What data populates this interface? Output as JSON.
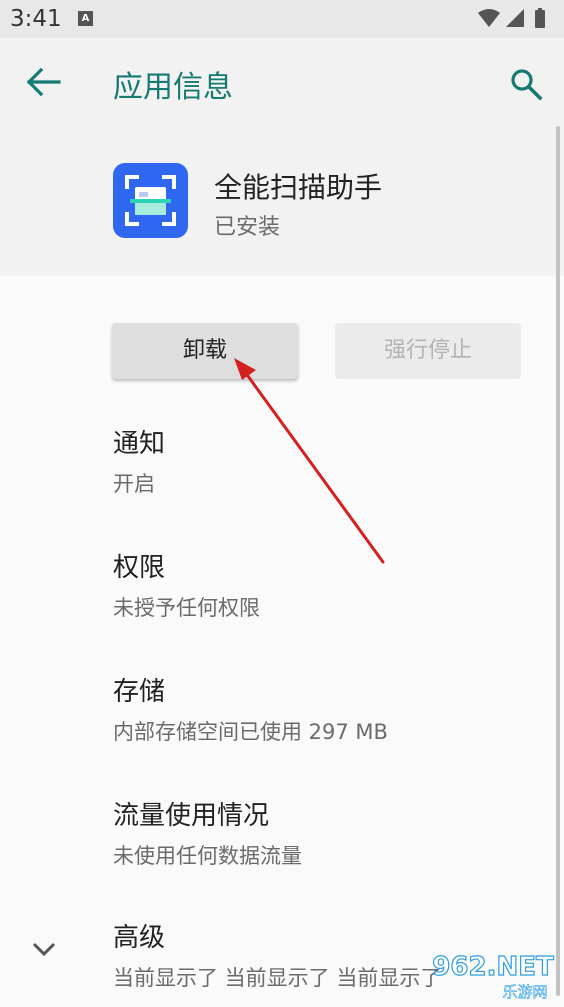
{
  "status_bar": {
    "time": "3:41",
    "notification_badge": "A",
    "icons": [
      "wifi-icon",
      "signal-icon",
      "battery-icon"
    ]
  },
  "app_bar": {
    "title": "应用信息",
    "back_icon": "arrow-back-icon",
    "search_icon": "search-icon"
  },
  "app": {
    "name": "全能扫描助手",
    "status": "已安装",
    "icon": "scanner-app-icon",
    "icon_color": "#2f67f0"
  },
  "buttons": {
    "uninstall": "卸载",
    "force_stop": "强行停止"
  },
  "items": [
    {
      "title": "通知",
      "subtitle": "开启"
    },
    {
      "title": "权限",
      "subtitle": "未授予任何权限"
    },
    {
      "title": "存储",
      "subtitle": "内部存储空间已使用 297 MB"
    },
    {
      "title": "流量使用情况",
      "subtitle": "未使用任何数据流量"
    },
    {
      "title": "高级",
      "subtitle": "当前显示了 当前显示了 当前显示了"
    }
  ],
  "watermark": {
    "line1": "962.NET",
    "line2": "乐游网"
  },
  "colors": {
    "accent": "#147a72",
    "annotation_arrow": "#d42020"
  }
}
